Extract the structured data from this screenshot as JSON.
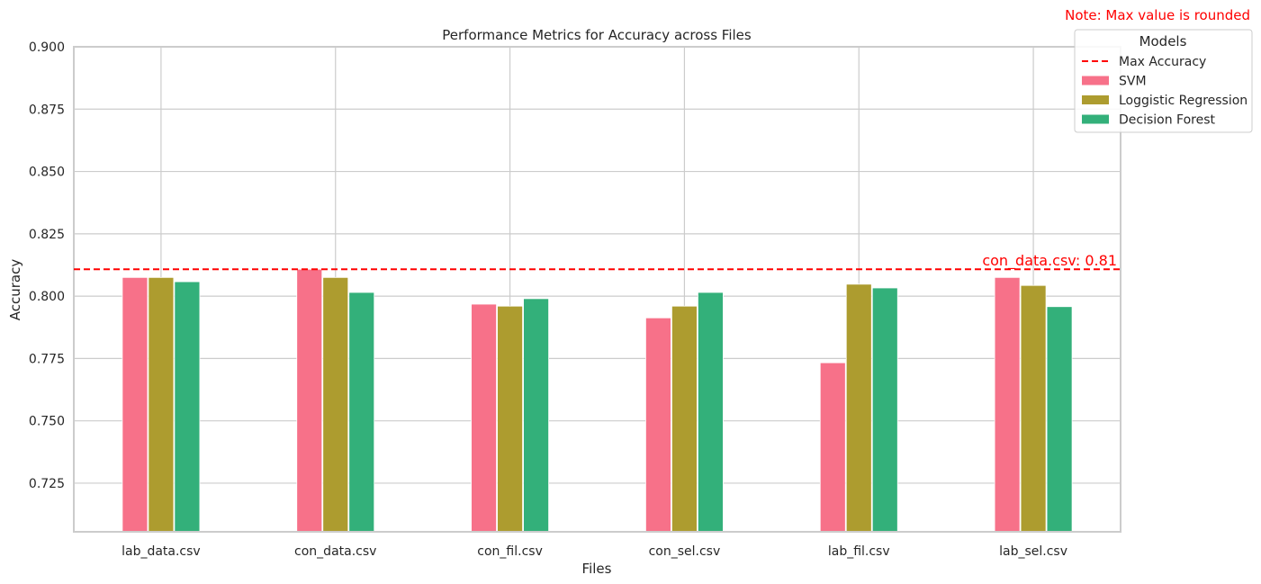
{
  "chart_data": {
    "type": "bar",
    "title": "Performance Metrics for Accuracy across Files",
    "xlabel": "Files",
    "ylabel": "Accuracy",
    "categories": [
      "lab_data.csv",
      "con_data.csv",
      "con_fil.csv",
      "con_sel.csv",
      "lab_fil.csv",
      "lab_sel.csv"
    ],
    "series": [
      {
        "name": "SVM",
        "color": "#f77189",
        "values": [
          0.8075,
          0.8108,
          0.7968,
          0.7913,
          0.7733,
          0.8075
        ]
      },
      {
        "name": "Loggistic Regression",
        "color": "#ad9c2f",
        "values": [
          0.8075,
          0.8075,
          0.796,
          0.796,
          0.8048,
          0.8043
        ]
      },
      {
        "name": "Decision Forest",
        "color": "#33b07a",
        "values": [
          0.8058,
          0.8015,
          0.799,
          0.8015,
          0.8033,
          0.7958
        ]
      }
    ],
    "ylim": [
      0.7055,
      0.9
    ],
    "yticks": [
      "0.725",
      "0.750",
      "0.775",
      "0.800",
      "0.825",
      "0.850",
      "0.875",
      "0.900"
    ],
    "grid": true,
    "max_line": {
      "value": 0.8108,
      "label": "Max Accuracy",
      "color": "#ff0000",
      "annotation": "con_data.csv: 0.81"
    },
    "legend": {
      "title": "Models",
      "placement": "top-right, outside"
    },
    "note": "Note: Max value is rounded",
    "note_color": "#ff0000"
  }
}
